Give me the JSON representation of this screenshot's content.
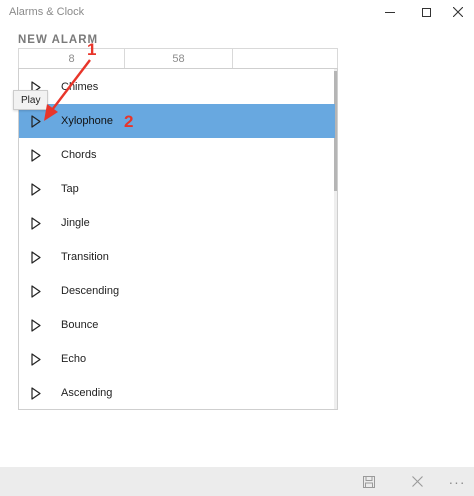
{
  "window": {
    "title": "Alarms & Clock"
  },
  "header": {
    "title": "NEW ALARM"
  },
  "time_picker": {
    "hour": "8",
    "minute": "58",
    "period": ""
  },
  "tooltip": {
    "text": "Play"
  },
  "sounds": {
    "selected_index": 1,
    "items": [
      {
        "label": "Chimes"
      },
      {
        "label": "Xylophone"
      },
      {
        "label": "Chords"
      },
      {
        "label": "Tap"
      },
      {
        "label": "Jingle"
      },
      {
        "label": "Transition"
      },
      {
        "label": "Descending"
      },
      {
        "label": "Bounce"
      },
      {
        "label": "Echo"
      },
      {
        "label": "Ascending"
      }
    ]
  },
  "annotations": {
    "marker_1": "1",
    "marker_2": "2"
  },
  "icons": {
    "minimize": "minimize-icon",
    "maximize": "maximize-icon",
    "close": "close-icon",
    "play": "play-icon",
    "save": "save-icon",
    "cancel": "cancel-icon",
    "more": "more-icon"
  },
  "colors": {
    "selected": "#68a8e0",
    "annotation": "#e8352a",
    "command_bar": "#ececec"
  }
}
